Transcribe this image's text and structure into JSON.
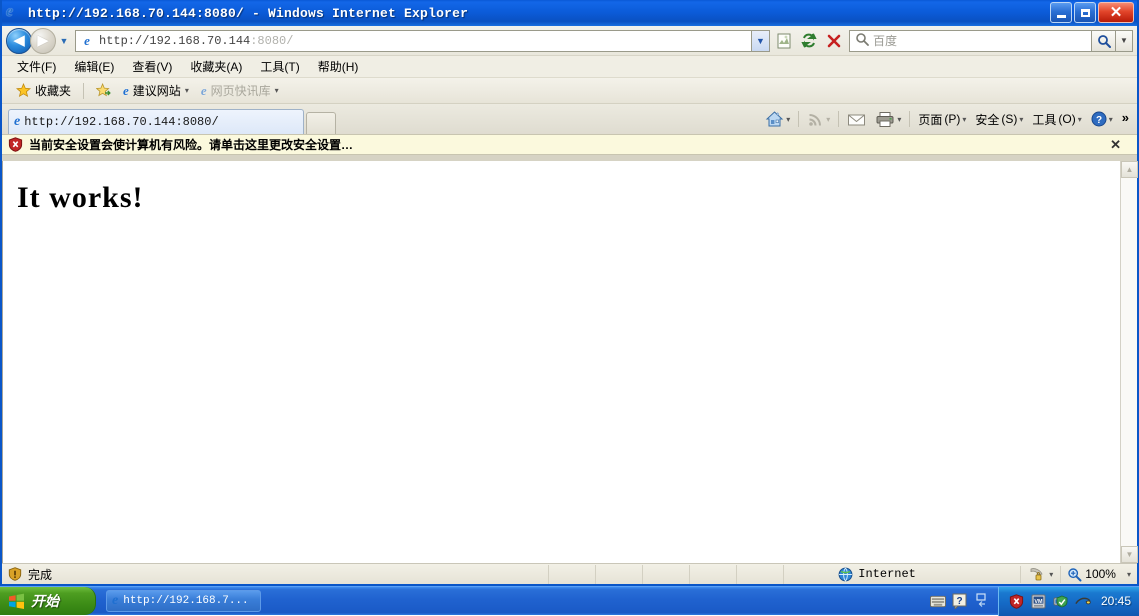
{
  "window": {
    "title": "http://192.168.70.144:8080/ - Windows Internet Explorer",
    "minimize_label": "",
    "restore_label": "",
    "close_label": "✕"
  },
  "navigation": {
    "back_glyph": "◀",
    "forward_glyph": "▶",
    "history_caret": "▼",
    "address_url_main": "http://192.168.70.144",
    "address_url_dim": ":8080/",
    "address_dropdown_caret": "▼",
    "compat_view_label": "",
    "refresh_glyph": "↻",
    "stop_glyph": "✕"
  },
  "search": {
    "placeholder": "百度",
    "go_glyph": "🔍",
    "dropdown_caret": "▼"
  },
  "menu": {
    "items": [
      {
        "label": "文件",
        "accel": "(F)"
      },
      {
        "label": "编辑",
        "accel": "(E)"
      },
      {
        "label": "查看",
        "accel": "(V)"
      },
      {
        "label": "收藏夹",
        "accel": "(A)"
      },
      {
        "label": "工具",
        "accel": "(T)"
      },
      {
        "label": "帮助",
        "accel": "(H)"
      }
    ]
  },
  "favorites_bar": {
    "favorites_label": "收藏夹",
    "items": [
      {
        "label": "建议网站",
        "caret": "▾",
        "dimmed": false
      },
      {
        "label": "网页快讯库",
        "caret": "▾",
        "dimmed": true
      }
    ]
  },
  "tabs": {
    "items": [
      {
        "label": "http://192.168.70.144:8080/"
      }
    ],
    "new_tab_label": ""
  },
  "command_bar": {
    "home_caret": "▾",
    "feeds_caret": "▾",
    "print_caret": "▾",
    "page_label": "页面",
    "page_accel": "(P)",
    "page_caret": "▾",
    "safety_label": "安全",
    "safety_accel": "(S)",
    "safety_caret": "▾",
    "tools_label": "工具",
    "tools_accel": "(O)",
    "tools_caret": "▾",
    "help_caret": "▾",
    "overflow_glyph": "»"
  },
  "info_bar": {
    "message": "当前安全设置会使计算机有风险。请单击这里更改安全设置…",
    "close_glyph": "✕"
  },
  "page": {
    "heading": "It works!"
  },
  "scrollbar": {
    "up_glyph": "▲",
    "down_glyph": "▼"
  },
  "status_bar": {
    "status_text": "完成",
    "zone_label": "Internet",
    "protected_caret": "▾",
    "zoom_level": "100%",
    "zoom_caret": "▾"
  },
  "taskbar": {
    "start_label": "开始",
    "items": [
      {
        "label": "http://192.168.7..."
      }
    ],
    "clock": "20:45"
  },
  "colors": {
    "title_blue": "#0b5bd8",
    "taskbar_blue": "#2062cf",
    "start_green": "#4e9e21",
    "info_bar_yellow": "#fbf9dd",
    "close_red": "#e2452a"
  }
}
